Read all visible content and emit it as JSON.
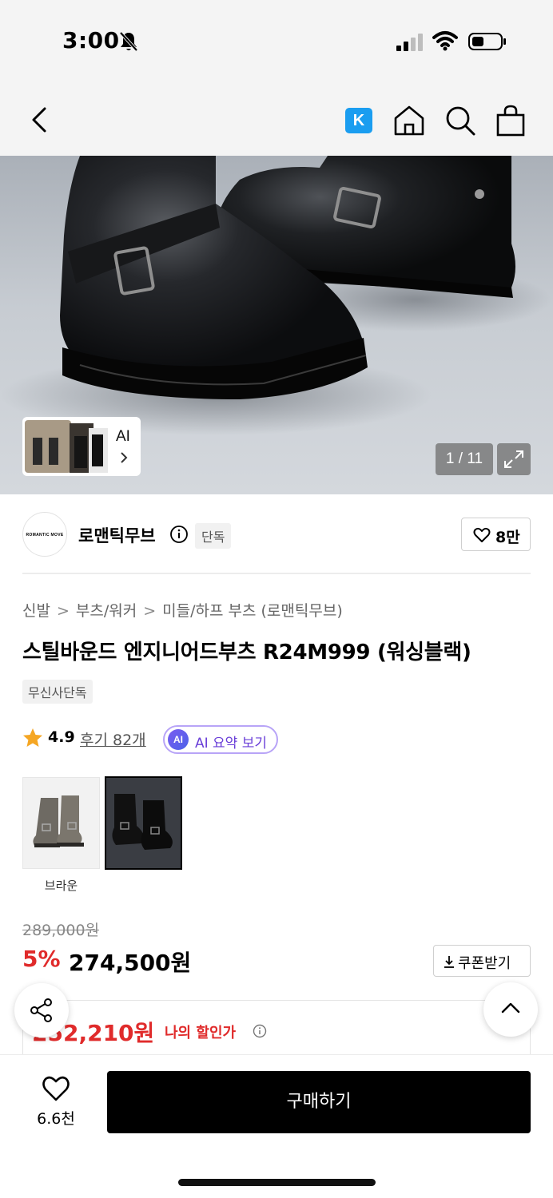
{
  "status_bar": {
    "time": "3:00"
  },
  "nav": {
    "kakao_badge": "K"
  },
  "hero": {
    "ai_label": "AI",
    "counter": "1 / 11"
  },
  "brand": {
    "logo_text": "ROMANTIC MOVE",
    "name": "로맨틱무브",
    "exclusive_tag": "단독",
    "likes": "8만"
  },
  "breadcrumb": {
    "items": [
      "신발",
      "부츠/워커",
      "미들/하프 부츠 (로맨틱무브)"
    ],
    "separator": ">"
  },
  "product": {
    "title": "스틸바운드 엔지니어드부츠 R24M999 (워싱블랙)",
    "exclusive_tag": "무신사단독",
    "rating": "4.9",
    "reviews": "후기 82개",
    "ai_summary_badge": "AI",
    "ai_summary_label": "AI 요약 보기"
  },
  "options": [
    {
      "label": "브라운",
      "selected": false
    },
    {
      "label": "",
      "selected": true
    }
  ],
  "price": {
    "original": "289,000원",
    "discount": "5%",
    "sale": "274,500원",
    "coupon_label": "쿠폰받기",
    "my_price": "252,210원",
    "my_price_label": "나의 할인가"
  },
  "bottom_bar": {
    "wish_count": "6.6천",
    "buy_label": "구매하기"
  },
  "colors": {
    "accent_red": "#e02b2b",
    "ai_purple": "#6a3fd8",
    "kakao_blue": "#1a9df0",
    "star": "#f5a623"
  }
}
